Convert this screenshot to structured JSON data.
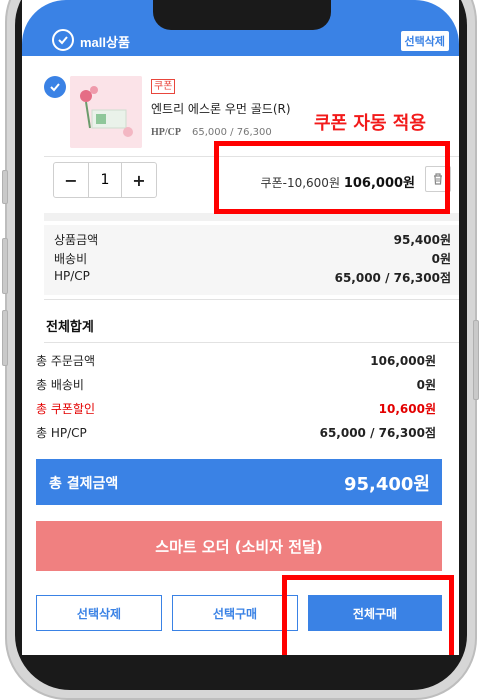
{
  "colors": {
    "accent": "#3a82e5",
    "danger": "#e30000",
    "annotation": "#f21a1a",
    "smart_button": "#f08080"
  },
  "header": {
    "check_icon": "check-circle-icon",
    "title": "mall상품",
    "action_label": "선택삭제"
  },
  "product": {
    "coupon_tag": "쿠폰",
    "name": "엔트리 에스론 우먼 골드(R)",
    "hp_label": "HP/CP",
    "hp_value": "65,000 / 76,300"
  },
  "annotation": {
    "text": "쿠폰 자동 적용"
  },
  "quantity": {
    "minus": "−",
    "value": "1",
    "plus": "+"
  },
  "line_price": {
    "coupon_text": "쿠폰-10,600원",
    "price": "106,000원",
    "delete_icon": "trash-icon"
  },
  "item_summary": [
    {
      "label": "상품금액",
      "value": "95,400원"
    },
    {
      "label": "배송비",
      "value": "0원"
    },
    {
      "label": "HP/CP",
      "value": "65,000 / 76,300점"
    }
  ],
  "totals": {
    "title": "전체합계",
    "rows": [
      {
        "label": "총 주문금액",
        "value": "106,000원"
      },
      {
        "label": "총 배송비",
        "value": "0원"
      },
      {
        "label": "총 쿠폰할인",
        "value": "10,600원"
      },
      {
        "label": "총 HP/CP",
        "value": "65,000 / 76,300점"
      }
    ]
  },
  "payment": {
    "label": "총 결제금액",
    "value": "95,400원"
  },
  "smart_order": {
    "label": "스마트 오더 (소비자 전달)"
  },
  "bottom": {
    "delete_selected": "선택삭제",
    "buy_selected": "선택구매",
    "buy_all": "전체구매"
  }
}
